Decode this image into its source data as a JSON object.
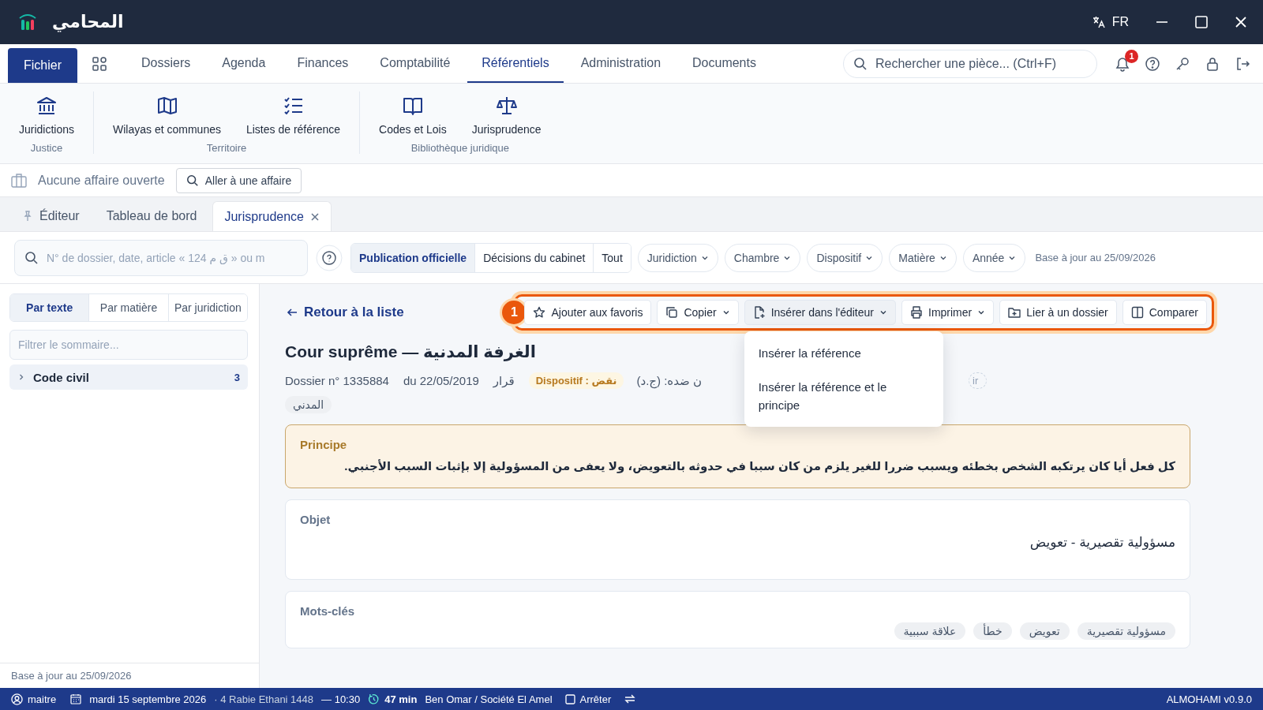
{
  "app": {
    "name": "المحامي",
    "language": "FR"
  },
  "menu": {
    "file": "Fichier",
    "items": [
      {
        "label": "Dossiers",
        "selected": false
      },
      {
        "label": "Agenda",
        "selected": false
      },
      {
        "label": "Finances",
        "selected": false
      },
      {
        "label": "Comptabilité",
        "selected": false
      },
      {
        "label": "Référentiels",
        "selected": true
      },
      {
        "label": "Administration",
        "selected": false
      },
      {
        "label": "Documents",
        "selected": false
      }
    ],
    "search": {
      "placeholder": "Rechercher une pièce... (Ctrl+F)"
    },
    "notifications": "1"
  },
  "ribbon": {
    "groups": [
      {
        "label": "Justice",
        "items": [
          {
            "label": "Juridictions",
            "kind": "court"
          }
        ]
      },
      {
        "label": "Territoire",
        "items": [
          {
            "label": "Wilayas et communes",
            "kind": "map"
          },
          {
            "label": "Listes de référence",
            "kind": "list"
          }
        ]
      },
      {
        "label": "Bibliothèque juridique",
        "items": [
          {
            "label": "Codes et Lois",
            "kind": "book"
          },
          {
            "label": "Jurisprudence",
            "kind": "scale"
          }
        ]
      }
    ]
  },
  "case_bar": {
    "status": "Aucune affaire ouverte",
    "button": "Aller à une affaire"
  },
  "tabs": [
    {
      "label": "Éditeur",
      "kind": "pinned",
      "selected": false
    },
    {
      "label": "Tableau de bord",
      "kind": "plain",
      "selected": false
    },
    {
      "label": "Jurisprudence",
      "kind": "closable",
      "selected": true
    }
  ],
  "filters": {
    "search": {
      "placeholder": "N° de dossier, date, article « 124 ق م » ou m"
    },
    "sources": [
      {
        "label": "Publication officielle",
        "selected": true
      },
      {
        "label": "Décisions du cabinet",
        "selected": false
      },
      {
        "label": "Tout",
        "selected": false
      }
    ],
    "dropdowns": [
      "Juridiction",
      "Chambre",
      "Dispositif",
      "Matière",
      "Année"
    ],
    "updated": "Base à jour au 25/09/2026"
  },
  "sidebar": {
    "modes": [
      {
        "label": "Par texte",
        "selected": true
      },
      {
        "label": "Par matière",
        "selected": false
      },
      {
        "label": "Par juridiction",
        "selected": false
      }
    ],
    "filter": {
      "placeholder": "Filtrer le sommaire..."
    },
    "tree": [
      {
        "label": "Code civil",
        "count": "3",
        "expanded": false
      }
    ],
    "footer": "Base à jour au 25/09/2026"
  },
  "detail": {
    "back": "Retour à la liste",
    "step": "1",
    "actions": [
      {
        "label": "Ajouter aux favoris",
        "kind": "star",
        "dropdown": false,
        "open": false
      },
      {
        "label": "Copier",
        "kind": "copy",
        "dropdown": true,
        "open": false
      },
      {
        "label": "Insérer dans l'éditeur",
        "kind": "insert",
        "dropdown": true,
        "open": true
      },
      {
        "label": "Imprimer",
        "kind": "print",
        "dropdown": true,
        "open": false
      },
      {
        "label": "Lier à un dossier",
        "kind": "folder",
        "dropdown": false,
        "open": false
      },
      {
        "label": "Comparer",
        "kind": "compare",
        "dropdown": false,
        "open": false
      }
    ],
    "menu": [
      "Insérer la référence",
      "Insérer la référence et le principe"
    ],
    "title": "Cour suprême — الغرفة المدنية",
    "meta": [
      "Dossier n° 1335884",
      "du 22/05/2019",
      "قرار"
    ],
    "outcome": "Dispositif : نقض",
    "meta_cut": "ن ضده: (ج.د)",
    "chip_cut": "ir",
    "tag": "المدني",
    "principle": {
      "label": "Principe",
      "text": "كل فعل أيا كان يرتكبه الشخص بخطئه ويسبب ضررا للغير يلزم من كان سببا في حدوثه بالتعويض، ولا يعفى من المسؤولية إلا بإثبات السبب الأجنبي."
    },
    "object": {
      "label": "Objet",
      "text": "مسؤولية تقصيرية - تعويض"
    },
    "keywords": {
      "label": "Mots-clés",
      "items": [
        "مسؤولية تقصيرية",
        "تعويض",
        "خطأ",
        "علاقة سببية"
      ]
    }
  },
  "status": {
    "user": "maitre",
    "date": "mardi 15 septembre 2026",
    "hijri": "· 4 Rabie Ethani 1448",
    "time": "— 10:30",
    "timer": "47 min",
    "client": "Ben Omar / Société El Amel",
    "stop": "Arrêter",
    "version": "ALMOHAMI v0.9.0"
  }
}
